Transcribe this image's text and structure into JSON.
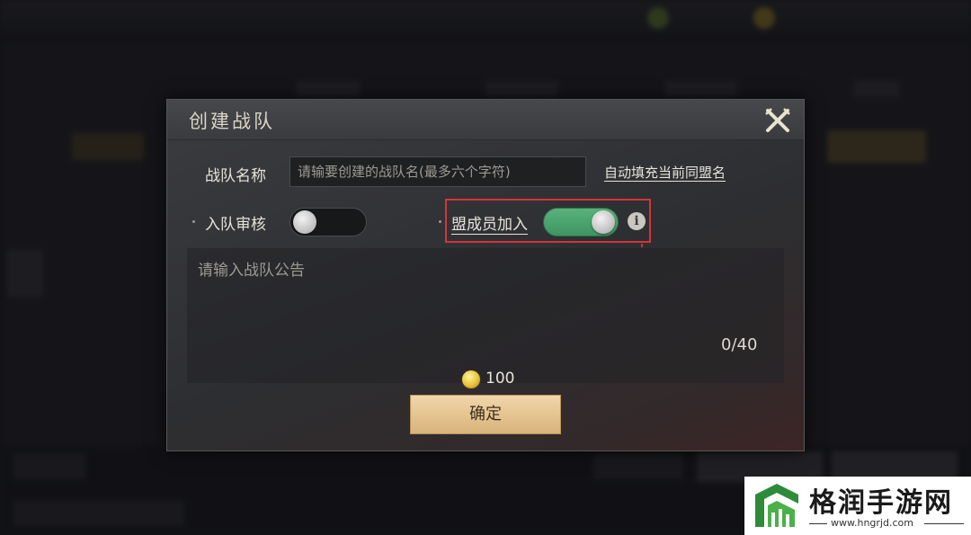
{
  "dialog": {
    "title": "创建战队",
    "close_icon": "crossed-swords-close-icon"
  },
  "form": {
    "name_label": "战队名称",
    "name_placeholder": "请输要创建的战队名(最多六个字符)",
    "name_value": "",
    "autofill_link": "自动填充当前同盟名",
    "review_label": "入队审核",
    "review_enabled": false,
    "member_join_label": "盟成员加入",
    "member_join_enabled": true,
    "info_icon": "info-icon",
    "notice_placeholder": "请输入战队公告",
    "notice_value": "",
    "char_count": "0/40",
    "cost_value": "100",
    "confirm_label": "确定"
  },
  "colors": {
    "toggle_on": "#4fa56f",
    "highlight": "#d6333a",
    "confirm_bg": "#e3c18c"
  },
  "watermark": {
    "name": "格润手游网",
    "url": "www.hngrjd.com"
  }
}
